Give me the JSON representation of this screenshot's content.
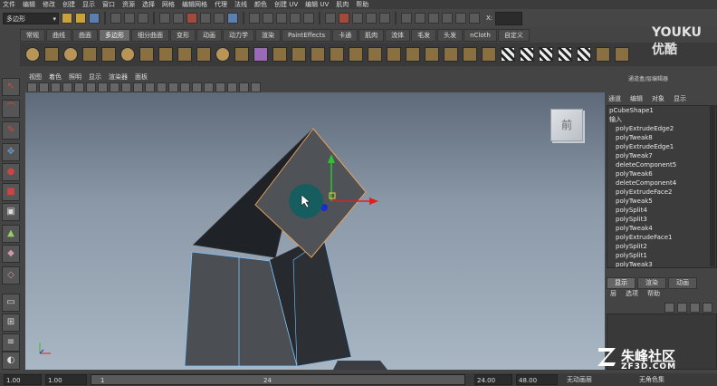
{
  "menubar": [
    "文件",
    "编辑",
    "修改",
    "创建",
    "显示",
    "窗口",
    "资源",
    "选择",
    "网格",
    "编辑网格",
    "代理",
    "法线",
    "颜色",
    "创建 UV",
    "编辑 UV",
    "肌肉",
    "帮助"
  ],
  "status": {
    "mode": "多边形",
    "field_label": "X:"
  },
  "shelf_tabs": [
    {
      "label": "常规",
      "active": false
    },
    {
      "label": "曲线",
      "active": false
    },
    {
      "label": "曲面",
      "active": false
    },
    {
      "label": "多边形",
      "active": true
    },
    {
      "label": "细分曲面",
      "active": false
    },
    {
      "label": "变形",
      "active": false
    },
    {
      "label": "动画",
      "active": false
    },
    {
      "label": "动力学",
      "active": false
    },
    {
      "label": "渲染",
      "active": false
    },
    {
      "label": "PaintEffects",
      "active": false
    },
    {
      "label": "卡通",
      "active": false
    },
    {
      "label": "肌肉",
      "active": false
    },
    {
      "label": "流体",
      "active": false
    },
    {
      "label": "毛发",
      "active": false
    },
    {
      "label": "头发",
      "active": false
    },
    {
      "label": "nCloth",
      "active": false
    },
    {
      "label": "自定义",
      "active": false
    }
  ],
  "viewport_menu": [
    "视图",
    "着色",
    "照明",
    "显示",
    "渲染器",
    "面板"
  ],
  "viewcube_label": "前",
  "right_panel": {
    "header": "通道盒/层编辑器",
    "tabs": [
      "通道",
      "编辑",
      "对象",
      "显示"
    ],
    "shape_name": "pCubeShape1",
    "inputs_label": "输入",
    "history": [
      "polyExtrudeEdge2",
      "polyTweak8",
      "polyExtrudeEdge1",
      "polyTweak7",
      "deleteComponent5",
      "polyTweak6",
      "deleteComponent4",
      "polyExtrudeFace2",
      "polyTweak5",
      "polySplit4",
      "polySplit3",
      "polyTweak4",
      "polyExtrudeFace1",
      "polySplit2",
      "polySplit1",
      "polyTweak3"
    ],
    "layer_tabs": [
      {
        "label": "显示",
        "active": true
      },
      {
        "label": "渲染",
        "active": false
      },
      {
        "label": "动画",
        "active": false
      }
    ],
    "layer_menu": [
      "层",
      "选项",
      "帮助"
    ]
  },
  "bottom": {
    "start": "1.00",
    "end": "1.00",
    "frame_start": "1",
    "frame_mark": "24",
    "range_end": "24.00",
    "range_max": "48.00",
    "anim_layer": "无动画层",
    "char_set": "无角色集"
  },
  "watermarks": {
    "youku": "YOUKU 优酷",
    "zf3d": "朱峰社区",
    "zf3d_url": "ZF3D.COM"
  }
}
